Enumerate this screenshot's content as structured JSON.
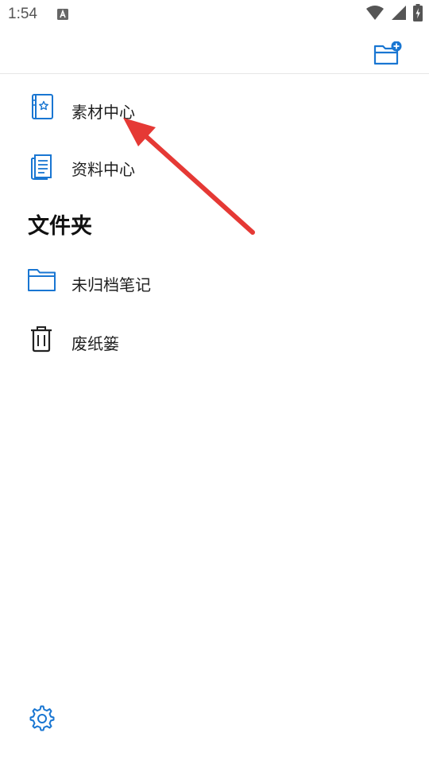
{
  "status_bar": {
    "time": "1:54",
    "notification_icon": "a-notification-icon",
    "wifi_icon": "wifi-icon",
    "signal_icon": "signal-icon",
    "battery_icon": "battery-charging-icon"
  },
  "toolbar": {
    "new_folder_icon": "folder-add-icon"
  },
  "menu": {
    "items": [
      {
        "label": "素材中心",
        "icon": "material-book-star-icon"
      },
      {
        "label": "资料中心",
        "icon": "document-stack-icon"
      }
    ]
  },
  "folders": {
    "title": "文件夹",
    "items": [
      {
        "label": "未归档笔记",
        "icon": "folder-icon"
      },
      {
        "label": "废纸篓",
        "icon": "trash-icon"
      }
    ]
  },
  "footer": {
    "settings_icon": "gear-icon"
  },
  "annotation": {
    "arrow_icon": "red-arrow-icon",
    "color": "#e53935"
  },
  "colors": {
    "accent": "#1976d2",
    "text": "#1f1f1f",
    "divider": "#e6e6e6"
  }
}
